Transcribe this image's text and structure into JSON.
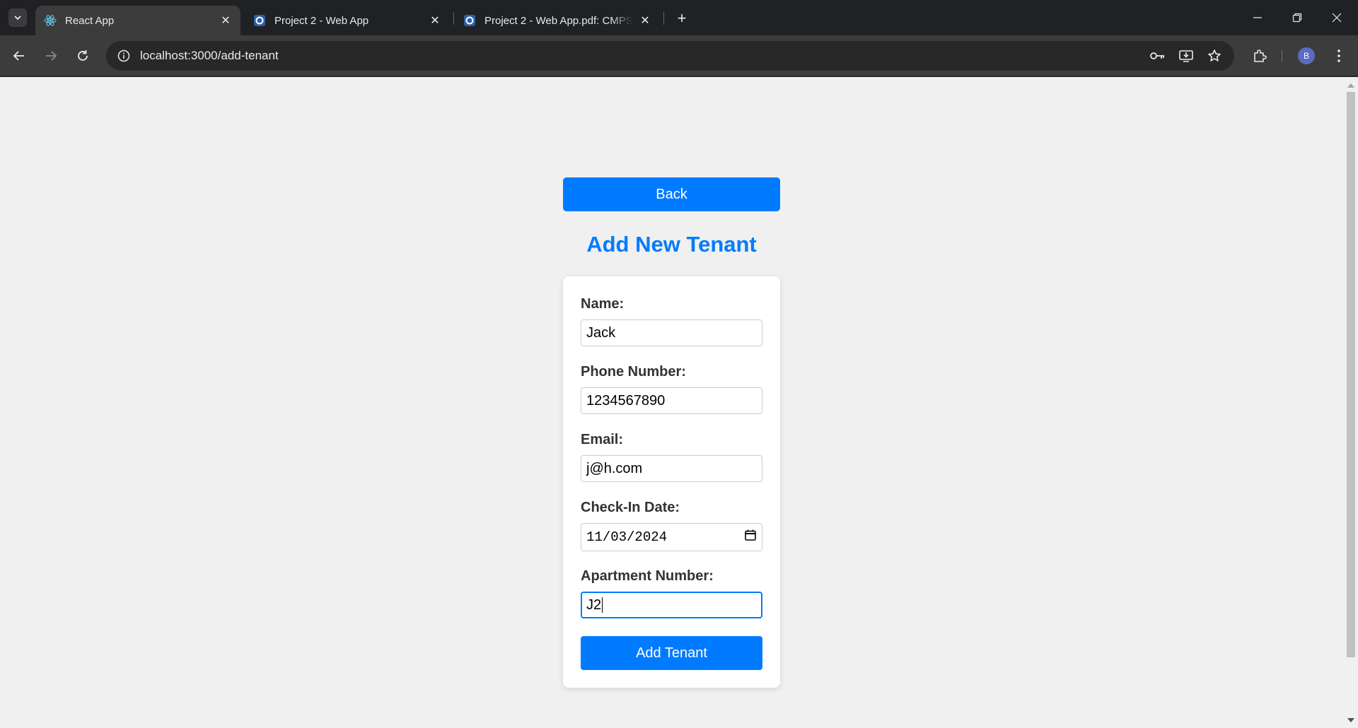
{
  "browser": {
    "tabs": [
      {
        "title": "React App",
        "active": true
      },
      {
        "title": "Project 2 - Web App",
        "active": false
      },
      {
        "title": "Project 2 - Web App.pdf: CMPSC",
        "active": false
      }
    ],
    "url": "localhost:3000/add-tenant",
    "profile_initial": "B"
  },
  "page": {
    "back_label": "Back",
    "title": "Add New Tenant",
    "form": {
      "name_label": "Name:",
      "name_value": "Jack",
      "phone_label": "Phone Number:",
      "phone_value": "1234567890",
      "email_label": "Email:",
      "email_value": "j@h.com",
      "checkin_label": "Check-In Date:",
      "checkin_value": "11/03/2024",
      "apartment_label": "Apartment Number:",
      "apartment_value": "J2",
      "submit_label": "Add Tenant"
    }
  },
  "colors": {
    "accent": "#007bff",
    "page_background": "#f0f0f0",
    "chrome_dark": "#202124",
    "chrome_toolbar": "#3c3c3c"
  }
}
